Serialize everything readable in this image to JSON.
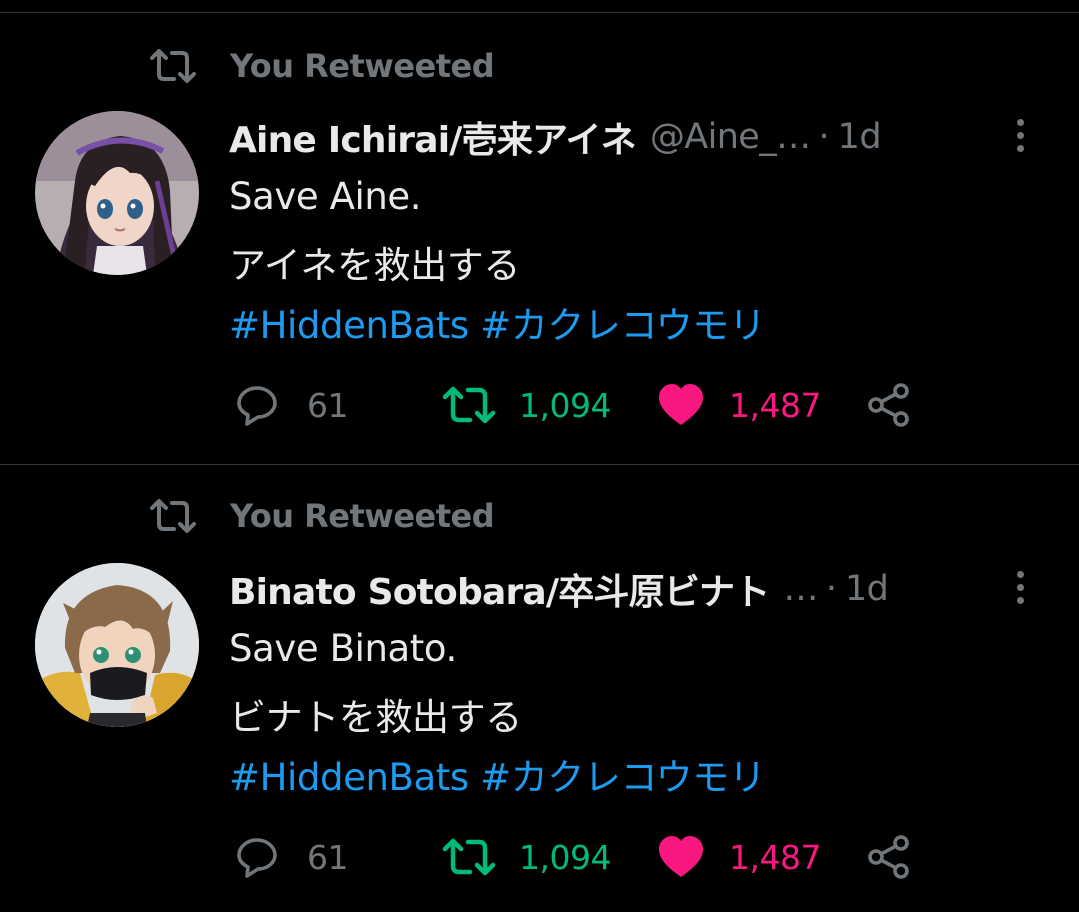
{
  "tweets": [
    {
      "retweet_label": "You Retweeted",
      "display_name": "Aine Ichirai/壱来アイネ",
      "handle": "@Aine_…",
      "separator": "·",
      "time": "1d",
      "body_line1": "Save Aine.",
      "body_line2": "アイネを救出する",
      "hashtag1": "#HiddenBats",
      "hashtag2": "#カクレコウモリ",
      "reply_count": "61",
      "retweet_count": "1,094",
      "like_count": "1,487"
    },
    {
      "retweet_label": "You Retweeted",
      "display_name": "Binato Sotobara/卒斗原ビナト",
      "handle": "…",
      "separator": "·",
      "time": "1d",
      "body_line1": "Save Binato.",
      "body_line2": "ビナトを救出する",
      "hashtag1": "#HiddenBats",
      "hashtag2": "#カクレコウモリ",
      "reply_count": "61",
      "retweet_count": "1,094",
      "like_count": "1,487"
    }
  ],
  "colors": {
    "background": "#000000",
    "text_primary": "#e7e9ea",
    "text_secondary": "#71767b",
    "link_blue": "#1d9bf0",
    "retweet_green": "#00ba7c",
    "like_pink": "#f91880",
    "divider": "#2f3336"
  },
  "icons": {
    "retweet_context": "retweet-icon",
    "reply": "reply-icon",
    "retweet": "retweet-icon",
    "like": "heart-icon",
    "share": "share-icon",
    "more": "more-vertical-icon"
  }
}
